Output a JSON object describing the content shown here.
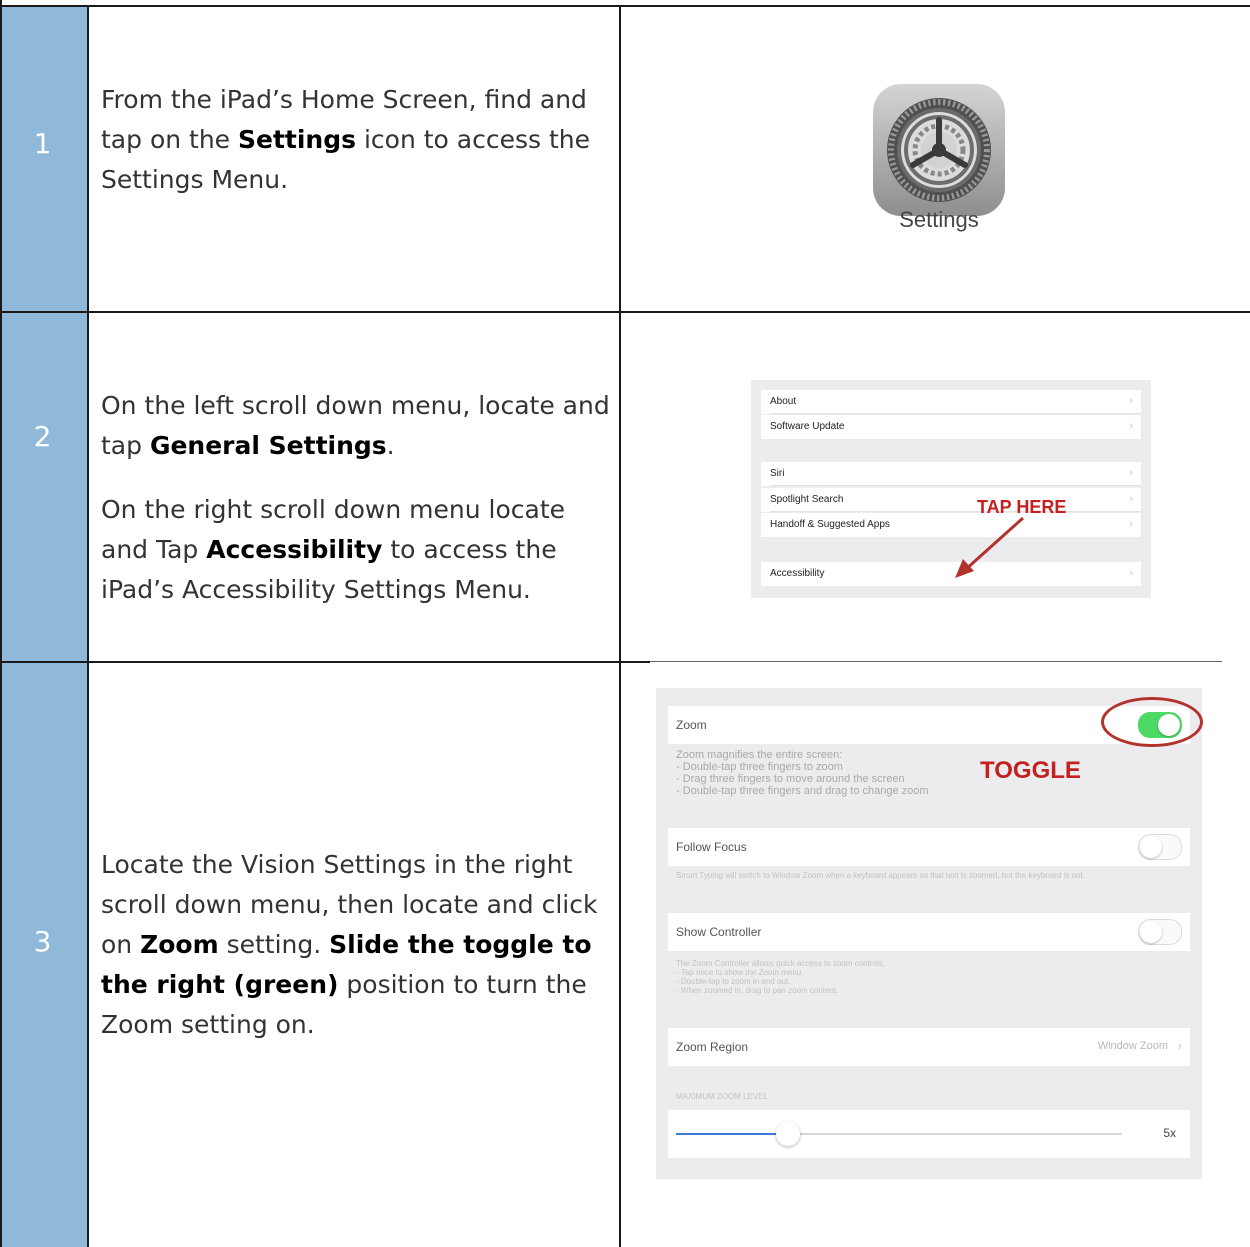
{
  "colors": {
    "number_column": "#8fb8d9",
    "callout_red": "#c3201e",
    "toggle_green": "#4cd964",
    "panel_grey": "#ececef"
  },
  "steps": [
    {
      "number": "1",
      "instructions": [
        {
          "t1": "From the iPad’s Home Screen, find and tap on the ",
          "b1": "Settings",
          "t2": " icon to access the Settings Menu."
        }
      ],
      "image": {
        "icon": "settings-gear-icon",
        "label": "Settings"
      }
    },
    {
      "number": "2",
      "instructions": [
        {
          "t1": "On the left scroll down menu, locate and tap ",
          "b1": "General Settings",
          "t2": "."
        },
        {
          "t1": "On the right scroll down menu locate and Tap ",
          "b1": "Accessibility",
          "t2": " to access the iPad’s Accessibility Settings Menu."
        }
      ],
      "image": {
        "rows": [
          "About",
          "Software Update",
          "Siri",
          "Spotlight Search",
          "Handoff & Suggested Apps",
          "Accessibility"
        ],
        "callout": "TAP HERE"
      }
    },
    {
      "number": "3",
      "instructions": [
        {
          "t1": "Locate the Vision Settings in the right scroll down menu, then locate and click on ",
          "b1": "Zoom",
          "t2": " setting. ",
          "b2": "Slide the toggle to the right (green)",
          "t3": " position to turn the Zoom setting on."
        }
      ],
      "image": {
        "callout": "TOGGLE",
        "zoom": {
          "label": "Zoom",
          "on": true,
          "description": [
            "Zoom magnifies the entire screen:",
            "- Double-tap three fingers to zoom",
            "- Drag three fingers to move around the screen",
            "- Double-tap three fingers and drag to change zoom"
          ]
        },
        "follow_focus": {
          "label": "Follow Focus",
          "on": false,
          "description": "Smart Typing will switch to Window Zoom when a keyboard appears so that text is zoomed, but the keyboard is not."
        },
        "show_controller": {
          "label": "Show Controller",
          "on": false,
          "description": [
            "The Zoom Controller allows quick access to zoom controls.",
            "- Tap once to show the Zoom menu.",
            "- Double-tap to zoom in and out.",
            "- When zoomed in, drag to pan zoom content."
          ]
        },
        "zoom_region": {
          "label": "Zoom Region",
          "value": "Window Zoom"
        },
        "max_zoom": {
          "header": "MAXIMUM ZOOM LEVEL",
          "value_label": "5x",
          "slider_fraction": 0.25
        }
      }
    }
  ]
}
